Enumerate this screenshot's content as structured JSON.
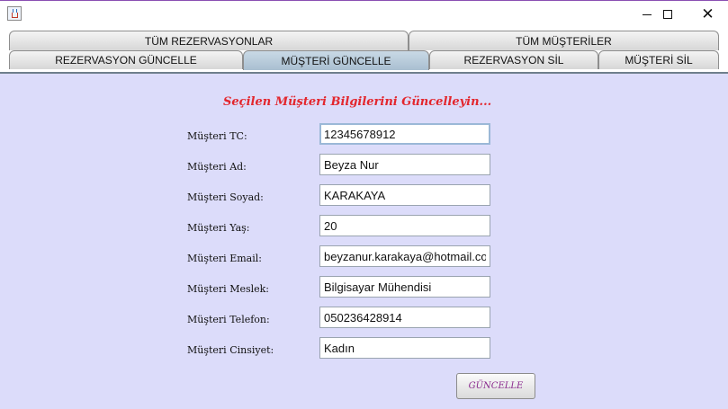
{
  "window": {
    "icon": "java-app-icon",
    "controls": {
      "minimize": "minimize-icon",
      "maximize": "maximize-icon",
      "close": "close-icon"
    },
    "close_glyph": "✕"
  },
  "tabs": {
    "row1": [
      "TÜM REZERVASYONLAR",
      "TÜM MÜŞTERİLER"
    ],
    "row2": [
      "REZERVASYON GÜNCELLE",
      "MÜŞTERİ GÜNCELLE",
      "REZERVASYON SİL",
      "MÜŞTERİ SİL"
    ],
    "selected": "MÜŞTERİ GÜNCELLE"
  },
  "form": {
    "heading": "Seçilen Müşteri Bilgilerini Güncelleyin...",
    "fields": [
      {
        "label": "Müşteri TC:",
        "value": "12345678912"
      },
      {
        "label": "Müşteri Ad:",
        "value": "Beyza Nur"
      },
      {
        "label": "Müşteri Soyad:",
        "value": "KARAKAYA"
      },
      {
        "label": "Müşteri Yaş:",
        "value": "20"
      },
      {
        "label": "Müşteri Email:",
        "value": "beyzanur.karakaya@hotmail.com"
      },
      {
        "label": "Müşteri Meslek:",
        "value": "Bilgisayar Mühendisi"
      },
      {
        "label": "Müşteri Telefon:",
        "value": "050236428914"
      },
      {
        "label": "Müşteri Cinsiyet:",
        "value": "Kadın"
      }
    ],
    "submit_label": "GÜNCELLE"
  },
  "colors": {
    "content_background": "#dcdcfa",
    "heading_text": "#e3262d",
    "button_text": "#8a2a8e",
    "selected_tab": "#b4c8d9"
  }
}
